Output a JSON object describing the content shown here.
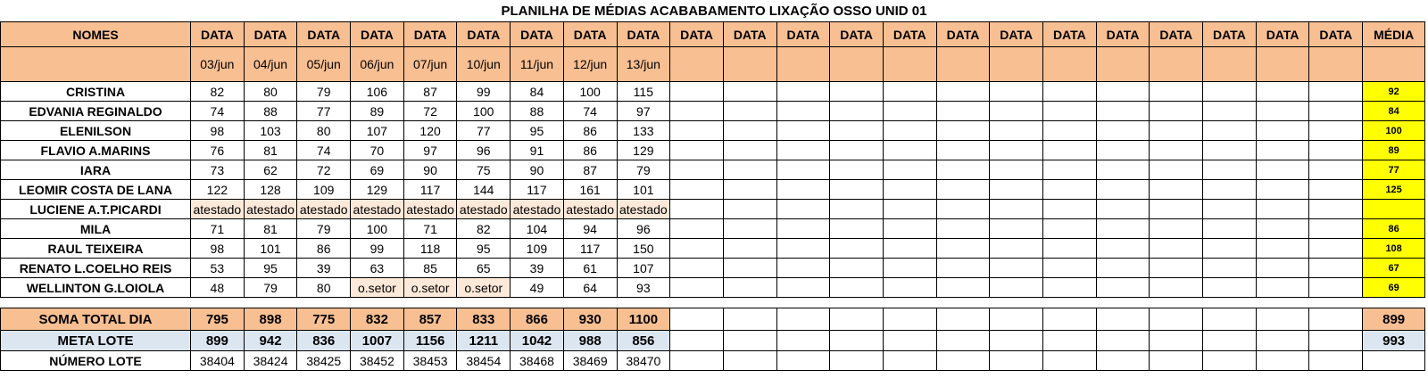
{
  "title": "PLANILHA DE MÉDIAS ACABABAMENTO LIXAÇÃO OSSO UNID 01",
  "header": {
    "names_label": "NOMES",
    "data_label": "DATA",
    "media_label": "MÉDIA",
    "dates": [
      "03/jun",
      "04/jun",
      "05/jun",
      "06/jun",
      "07/jun",
      "10/jun",
      "11/jun",
      "12/jun",
      "13/jun"
    ]
  },
  "rows": [
    {
      "name": "CRISTINA",
      "values": [
        "82",
        "80",
        "79",
        "106",
        "87",
        "99",
        "84",
        "100",
        "115"
      ],
      "media": "92"
    },
    {
      "name": "EDVANIA REGINALDO",
      "values": [
        "74",
        "88",
        "77",
        "89",
        "72",
        "100",
        "88",
        "74",
        "97"
      ],
      "media": "84"
    },
    {
      "name": "ELENILSON",
      "values": [
        "98",
        "103",
        "80",
        "107",
        "120",
        "77",
        "95",
        "86",
        "133"
      ],
      "media": "100"
    },
    {
      "name": "FLAVIO A.MARINS",
      "values": [
        "76",
        "81",
        "74",
        "70",
        "97",
        "96",
        "91",
        "86",
        "129"
      ],
      "media": "89"
    },
    {
      "name": "IARA",
      "values": [
        "73",
        "62",
        "72",
        "69",
        "90",
        "75",
        "90",
        "87",
        "79"
      ],
      "media": "77"
    },
    {
      "name": "LEOMIR COSTA DE LANA",
      "values": [
        "122",
        "128",
        "109",
        "129",
        "117",
        "144",
        "117",
        "161",
        "101"
      ],
      "media": "125"
    },
    {
      "name": "LUCIENE A.T.PICARDI",
      "values": [
        "atestado",
        "atestado",
        "atestado",
        "atestado",
        "atestado",
        "atestado",
        "atestado",
        "atestado",
        "atestado"
      ],
      "media": ""
    },
    {
      "name": "MILA",
      "values": [
        "71",
        "81",
        "79",
        "100",
        "71",
        "82",
        "104",
        "94",
        "96"
      ],
      "media": "86"
    },
    {
      "name": "RAUL TEIXEIRA",
      "values": [
        "98",
        "101",
        "86",
        "99",
        "118",
        "95",
        "109",
        "117",
        "150"
      ],
      "media": "108"
    },
    {
      "name": "RENATO L.COELHO REIS",
      "values": [
        "53",
        "95",
        "39",
        "63",
        "85",
        "65",
        "39",
        "61",
        "107"
      ],
      "media": "67"
    },
    {
      "name": "WELLINTON G.LOIOLA",
      "values": [
        "48",
        "79",
        "80",
        "o.setor",
        "o.setor",
        "o.setor",
        "49",
        "64",
        "93"
      ],
      "media": "69"
    }
  ],
  "soma": {
    "label": "SOMA TOTAL DIA",
    "values": [
      "795",
      "898",
      "775",
      "832",
      "857",
      "833",
      "866",
      "930",
      "1100"
    ],
    "media": "899"
  },
  "meta": {
    "label": "META LOTE",
    "values": [
      "899",
      "942",
      "836",
      "1007",
      "1156",
      "1211",
      "1042",
      "988",
      "856"
    ],
    "media": "993"
  },
  "lote": {
    "label": "NÚMERO LOTE",
    "values": [
      "38404",
      "38424",
      "38425",
      "38452",
      "38453",
      "38454",
      "38468",
      "38469",
      "38470"
    ]
  },
  "empty_date_columns": 13
}
